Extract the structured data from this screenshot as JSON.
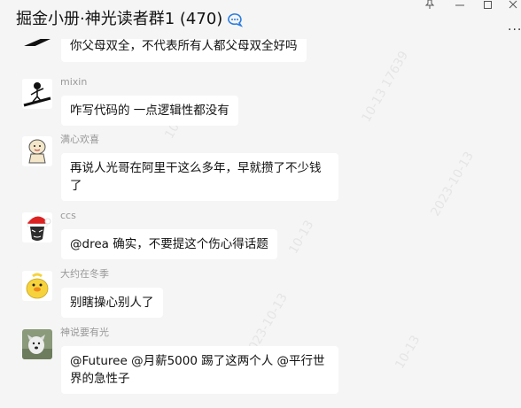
{
  "window": {
    "title": "掘金小册·神光读者群1 (470)",
    "more_label": "...",
    "icons": [
      "chat-bubble-icon",
      "pin-icon",
      "minimize-icon",
      "maximize-icon",
      "close-icon"
    ]
  },
  "messages": [
    {
      "sender": "",
      "text": "你父母双全，不代表所有人都父母双全好吗",
      "avatar": "black-white-avatar"
    },
    {
      "sender": "mixin",
      "text": "咋写代码的 一点逻辑性都没有",
      "avatar": "stick-figure-avatar"
    },
    {
      "sender": "满心欢喜",
      "text": "再说人光哥在阿里干这么多年，早就攒了不少钱了",
      "avatar": "cartoon-avatar"
    },
    {
      "sender": "ccs",
      "text": "@drea 确实，不要提这个伤心得话题",
      "avatar": "santa-hat-avatar"
    },
    {
      "sender": "大约在冬季",
      "text": "别瞎操心别人了",
      "avatar": "yellow-duck-avatar"
    },
    {
      "sender": "神说要有光",
      "text": "@Futuree @月薪5000 踢了这两个人 @平行世界的急性子",
      "avatar": "dog-avatar"
    }
  ],
  "colors": {
    "background": "#f5f5f5",
    "bubble": "#ffffff",
    "sender": "#999999",
    "accent": "#2a7de1"
  }
}
